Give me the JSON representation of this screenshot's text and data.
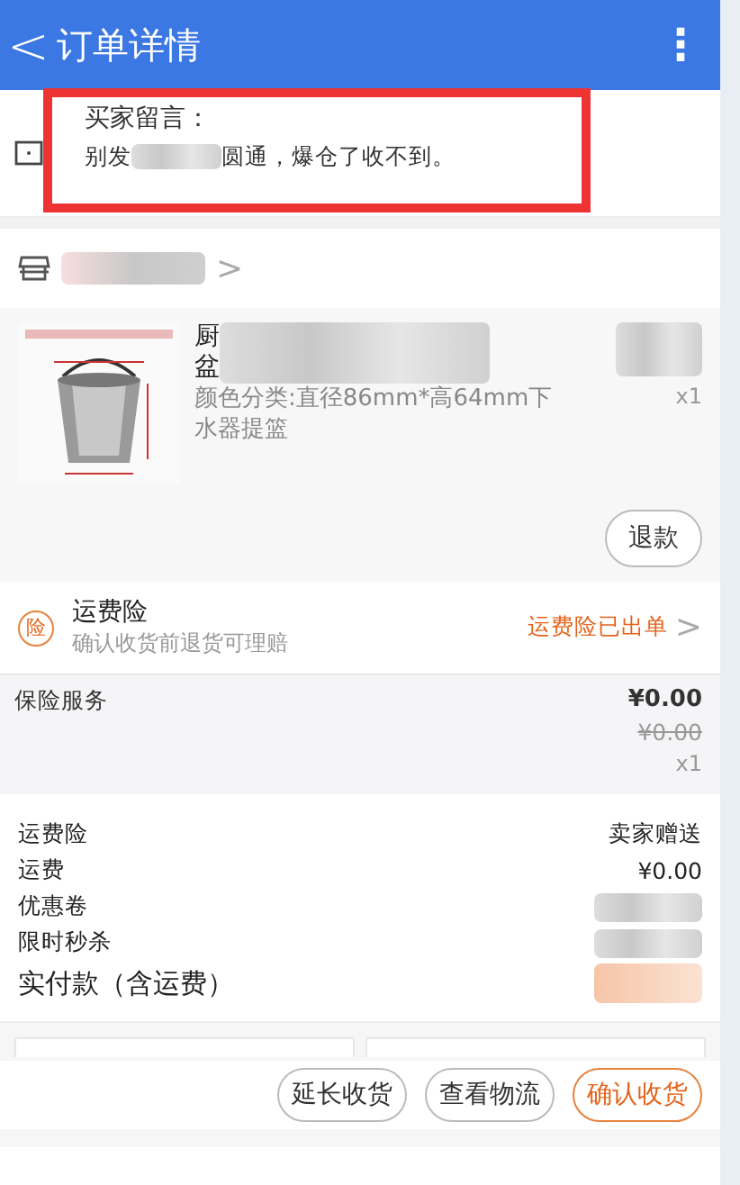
{
  "header": {
    "back": "<",
    "title": "订单详情",
    "menu": "⋮"
  },
  "message": {
    "label": "买家留言：",
    "text_before": "别发",
    "text_after": "圆通，爆仓了收不到。"
  },
  "shop": {
    "chevron": ">"
  },
  "product": {
    "title_lines": [
      "厨",
      "盆"
    ],
    "spec": "颜色分类:直径86mm*高64mm下水器提篮",
    "quantity": "x1",
    "refund": "退款"
  },
  "insurance": {
    "badge": "险",
    "title": "运费险",
    "subtitle": "确认收货前退货可理赔",
    "status": "运费险已出单",
    "chevron": ">"
  },
  "service": {
    "label": "保险服务",
    "price": "¥0.00",
    "original_price": "¥0.00",
    "quantity": "x1"
  },
  "summary": [
    {
      "label": "运费险",
      "value": "卖家赠送",
      "kind": "text"
    },
    {
      "label": "运费",
      "value": "¥0.00",
      "kind": "text"
    },
    {
      "label": "优惠卷",
      "kind": "hidden"
    },
    {
      "label": "限时秒杀",
      "kind": "hidden"
    },
    {
      "label": "实付款（含运费）",
      "kind": "total"
    }
  ],
  "actions": [
    {
      "label": "延长收货",
      "primary": false
    },
    {
      "label": "查看物流",
      "primary": false
    },
    {
      "label": "确认收货",
      "primary": true
    }
  ]
}
